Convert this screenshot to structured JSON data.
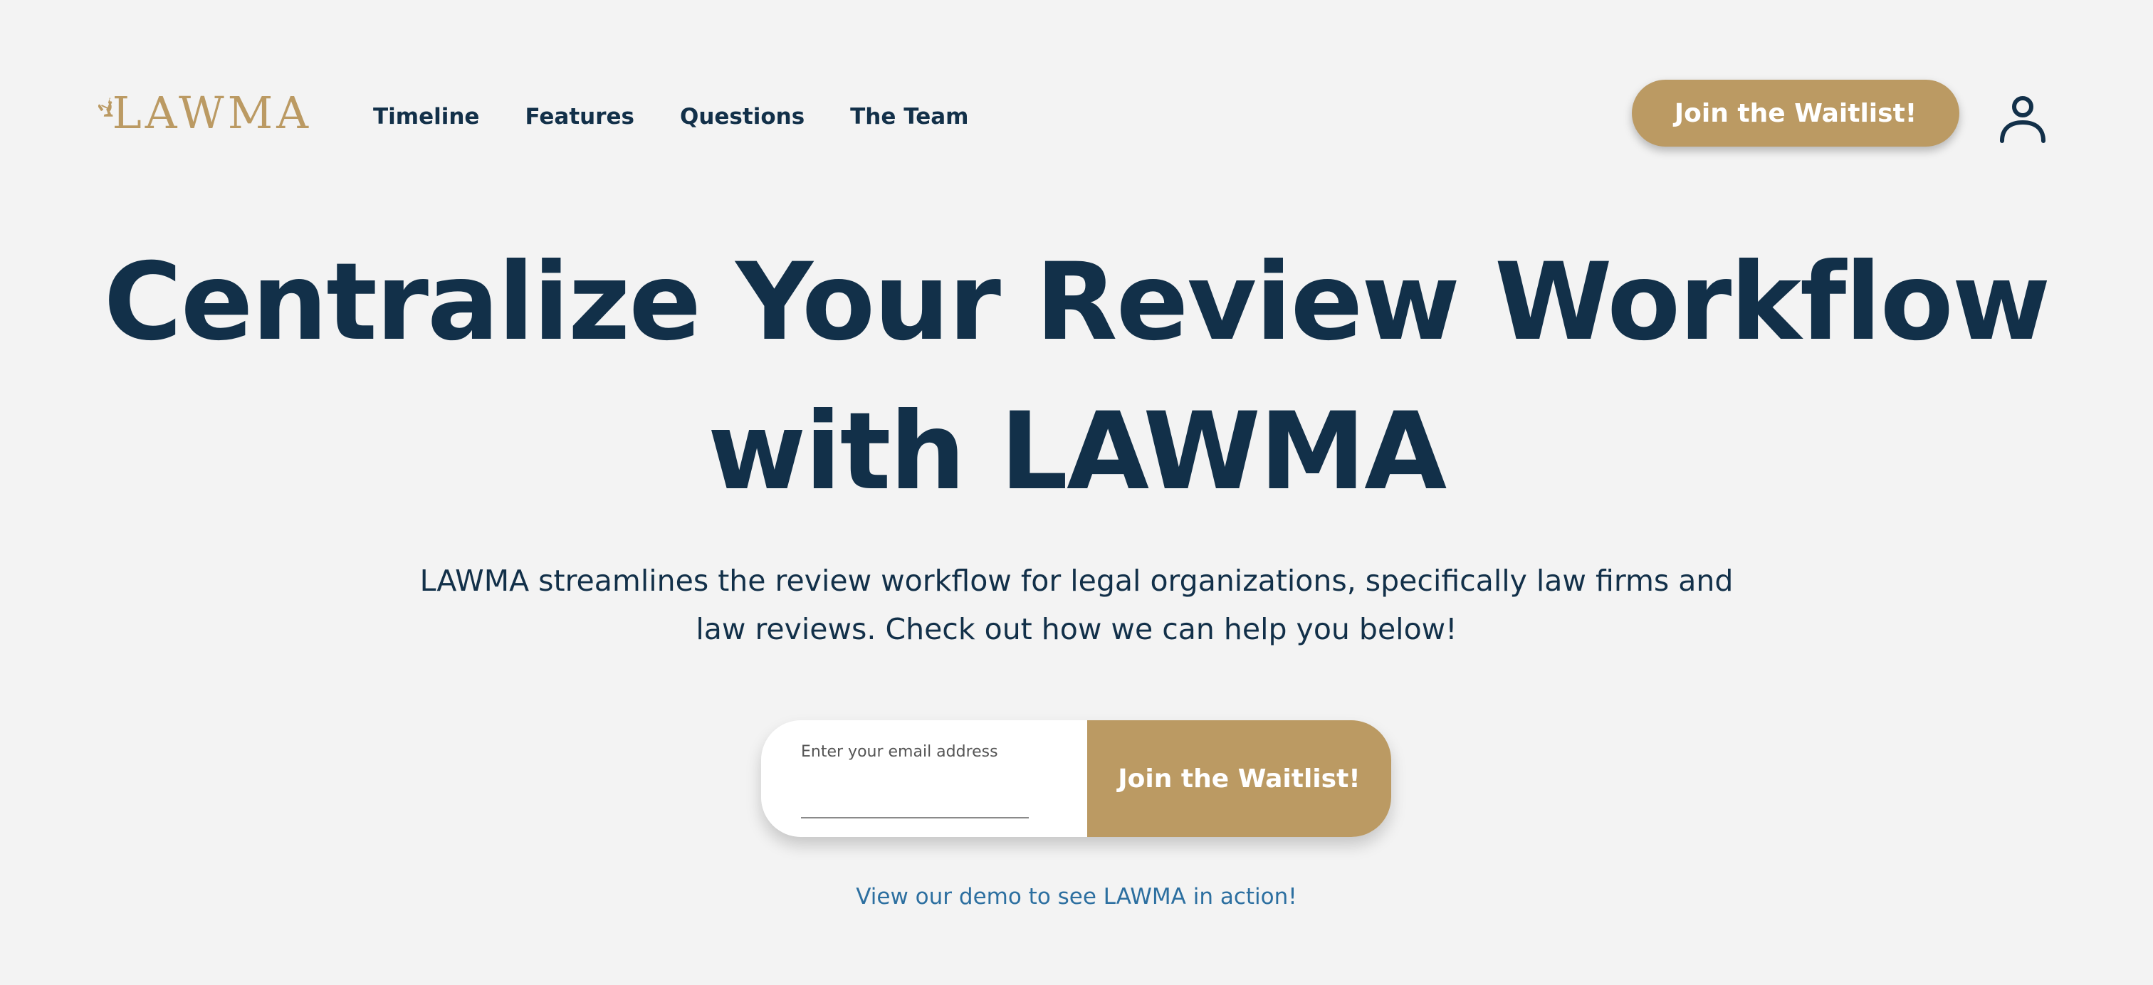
{
  "brand": {
    "logo_text": "LAWMA",
    "logo_icon": "kangaroo-gavel-icon",
    "accent_color": "#bb9a63",
    "primary_color": "#123049",
    "link_color": "#2c6fa0"
  },
  "nav": {
    "items": [
      {
        "label": "Timeline"
      },
      {
        "label": "Features"
      },
      {
        "label": "Questions"
      },
      {
        "label": "The Team"
      }
    ],
    "cta_label": "Join the Waitlist!",
    "account_icon": "user-icon"
  },
  "hero": {
    "title_line1": "Centralize Your Review Workflow",
    "title_line2": "with LAWMA",
    "subtitle": "LAWMA streamlines the review workflow for legal organizations, specifically law firms and law reviews. Check out how we can help you below!"
  },
  "signup": {
    "email_label": "Enter your email address",
    "email_value": "",
    "button_label": "Join the Waitlist!"
  },
  "demo_link_text": "View our demo to see LAWMA in action!"
}
